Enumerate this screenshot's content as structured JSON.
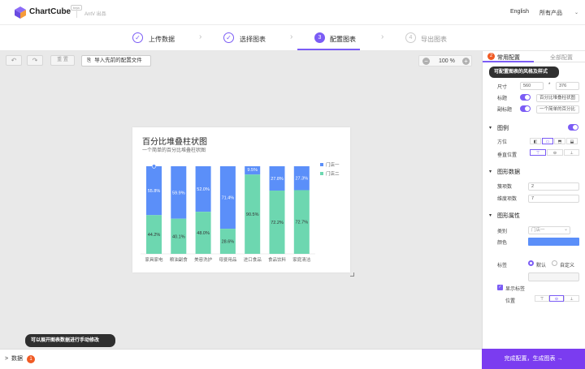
{
  "header": {
    "brand": "ChartCube",
    "beta": "beta",
    "provider": "AntV 出品",
    "language": "English",
    "products": "所有产品"
  },
  "steps": [
    {
      "label": "上传数据",
      "state": "done",
      "marker": "✓"
    },
    {
      "label": "选择图表",
      "state": "done",
      "marker": "✓"
    },
    {
      "label": "配置图表",
      "state": "current",
      "marker": "3"
    },
    {
      "label": "导出图表",
      "state": "next",
      "marker": "4"
    }
  ],
  "toolbar": {
    "undo": "↶",
    "redo": "↷",
    "reset": "重 置",
    "import_label": "导入先前的配置文件",
    "zoom": "100 %",
    "zoom_out": "−",
    "zoom_in": "+"
  },
  "chart_data": {
    "type": "bar",
    "stacked": "percent",
    "title": "百分比堆叠柱状图",
    "subtitle": "一个简单的百分比堆叠柱状图",
    "categories": [
      "家具家电",
      "粮油副食",
      "美容洗护",
      "母婴用品",
      "进口食品",
      "食品饮料",
      "家庭清洁"
    ],
    "series": [
      {
        "name": "门店一",
        "color": "#5b8ff9",
        "values": [
          55.8,
          59.9,
          52.0,
          71.4,
          9.5,
          27.8,
          27.3
        ],
        "labels": [
          "55.8%",
          "59.9%",
          "52.0%",
          "71.4%",
          "9.5%",
          "27.8%",
          "27.3%"
        ]
      },
      {
        "name": "门店二",
        "color": "#6dd7b0",
        "values": [
          44.2,
          40.1,
          48.0,
          28.6,
          90.5,
          72.2,
          72.7
        ],
        "labels": [
          "44.2%",
          "40.1%",
          "48.0%",
          "28.6%",
          "90.5%",
          "72.2%",
          "72.7%"
        ]
      }
    ],
    "ylim": [
      0,
      100
    ],
    "legend_position": "right"
  },
  "panel": {
    "tabs": {
      "common_badge": "2",
      "common": "常用配置",
      "all": "全部配置"
    },
    "tooltip": "可配置图表的风格及样式",
    "size": {
      "label": "尺寸",
      "width": "560",
      "sep": "*",
      "height": "376"
    },
    "title": {
      "label": "标题",
      "value": "百分比堆叠柱状图"
    },
    "subtitle": {
      "label": "副标题",
      "value": "一个简单的百分比"
    },
    "legend": {
      "section": "图例",
      "position_label": "方位",
      "vertical_label": "垂直位置"
    },
    "graph_data": {
      "section": "图形数据",
      "group_label": "簇项数",
      "group_value": "2",
      "dim_label": "维度项数",
      "dim_value": "7"
    },
    "graph_attr": {
      "section": "图形属性",
      "category_label": "类别",
      "category_value": "门店一",
      "color_label": "颜色",
      "color_value": "#5b8ff9"
    },
    "label": {
      "label": "标签",
      "option_default": "默认",
      "option_custom": "自定义",
      "show_label": "显示标签",
      "position_label": "位置"
    }
  },
  "bottom": {
    "tooltip": "可以展开图表数据进行手动修改",
    "data_label": "数据",
    "data_caret": ">",
    "data_badge": "1",
    "finish": "完成配置，生成图表 →"
  },
  "colors": {
    "accent": "#7b5cf5",
    "badge": "#f05a23",
    "series1": "#5b8ff9",
    "series2": "#6dd7b0"
  }
}
